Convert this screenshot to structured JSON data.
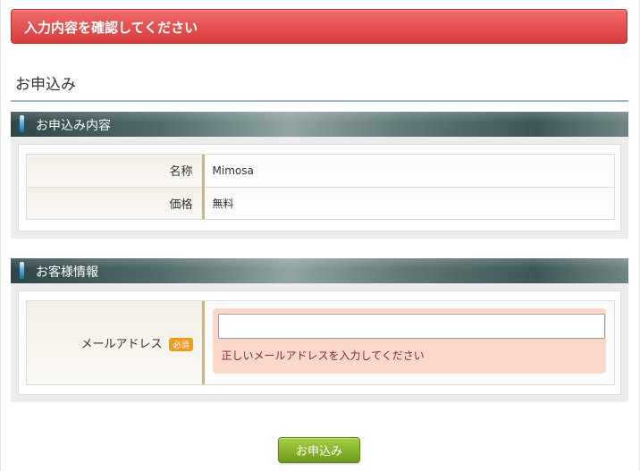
{
  "alert": {
    "message": "入力内容を確認してください"
  },
  "page": {
    "title": "お申込み"
  },
  "order_section": {
    "heading": "お申込み内容",
    "rows": [
      {
        "label": "名称",
        "value": "Mimosa"
      },
      {
        "label": "価格",
        "value": "無料"
      }
    ]
  },
  "customer_section": {
    "heading": "お客様情報",
    "email": {
      "label": "メールアドレス",
      "required_badge": "必須",
      "value": "",
      "placeholder": "",
      "error": "正しいメールアドレスを入力してください"
    }
  },
  "actions": {
    "submit_label": "お申込み"
  },
  "colors": {
    "alert": "#d63c3c",
    "submit": "#7aa823",
    "required_badge": "#f39a1d",
    "error_bg": "#fcd8cc"
  }
}
